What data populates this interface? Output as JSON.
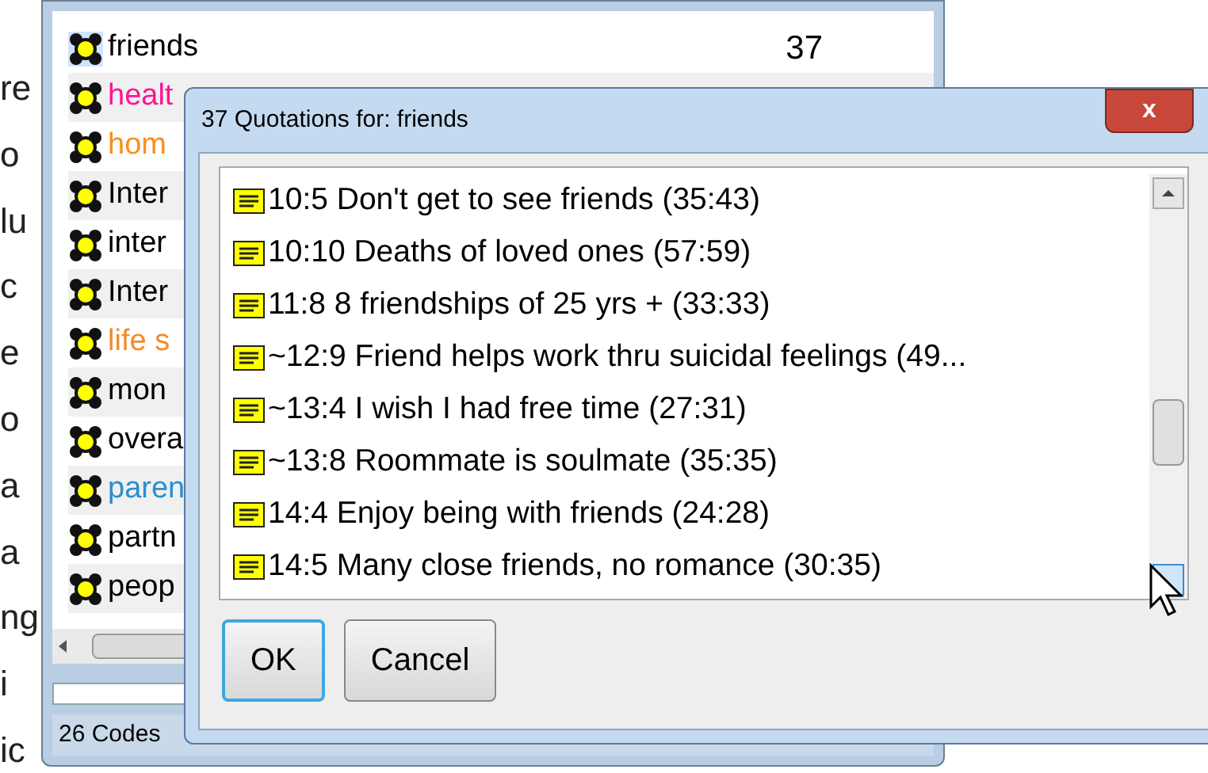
{
  "background_text": [
    "re",
    "o",
    "lu",
    "c",
    "e",
    "o",
    "a",
    "a",
    "ng",
    "i",
    "ic"
  ],
  "code_window": {
    "codes": [
      {
        "name": "friends",
        "count": "37",
        "color": "#000000",
        "selected": true
      },
      {
        "name": "healt",
        "color": "#ff1493",
        "selected": false
      },
      {
        "name": "hom",
        "color": "#ff8c1a",
        "selected": false
      },
      {
        "name": "Inter",
        "color": "#000000",
        "selected": false
      },
      {
        "name": "inter",
        "color": "#000000",
        "selected": false
      },
      {
        "name": "Inter",
        "color": "#000000",
        "selected": false
      },
      {
        "name": "life s",
        "color": "#f08c28",
        "selected": false
      },
      {
        "name": "mon",
        "color": "#000000",
        "selected": false
      },
      {
        "name": "overa",
        "color": "#000000",
        "selected": false
      },
      {
        "name": "paren",
        "color": "#2a8fd0",
        "selected": false
      },
      {
        "name": "partn",
        "color": "#000000",
        "selected": false
      },
      {
        "name": "peop",
        "color": "#000000",
        "selected": false
      }
    ],
    "status_bar": "26 Codes"
  },
  "dialog": {
    "title": "37 Quotations for: friends",
    "close": "x",
    "quotations": [
      {
        "text": "10:5 Don't get to see friends (35:43)"
      },
      {
        "text": "10:10 Deaths of loved ones (57:59)"
      },
      {
        "text": "11:8 8 friendships of 25 yrs + (33:33)"
      },
      {
        "text": "~12:9 Friend helps work thru suicidal feelings (49..."
      },
      {
        "text": "~13:4 I wish I had free time (27:31)"
      },
      {
        "text": "~13:8 Roommate is soulmate (35:35)"
      },
      {
        "text": "14:4 Enjoy being with friends (24:28)"
      },
      {
        "text": "14:5 Many close friends, no romance (30:35)"
      }
    ],
    "buttons": [
      {
        "label": "OK",
        "default": true
      },
      {
        "label": "Cancel",
        "default": false
      }
    ]
  }
}
